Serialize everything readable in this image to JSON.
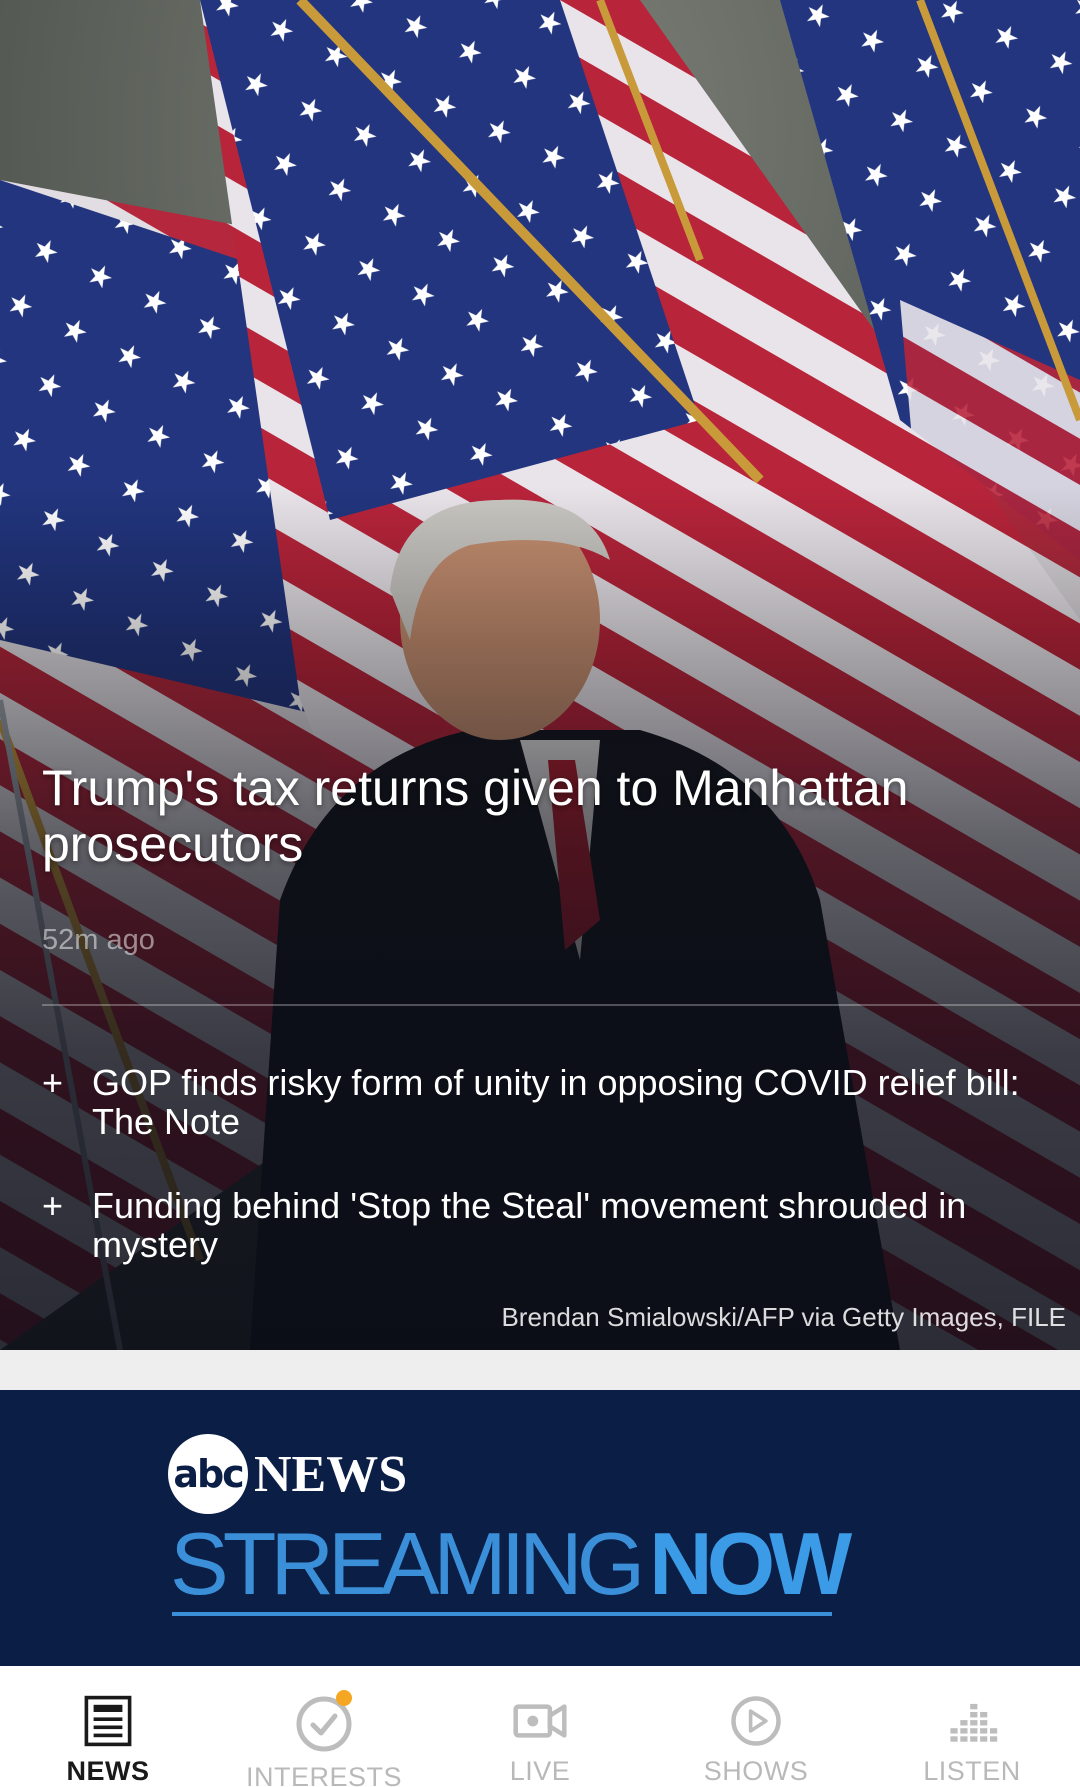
{
  "hero": {
    "title": "Trump's tax returns given to Manhattan prosecutors",
    "time_ago": "52m ago",
    "related": [
      {
        "icon": "plus-icon",
        "text": "GOP finds risky form of unity in opposing COVID relief bill: The Note"
      },
      {
        "icon": "plus-icon",
        "text": "Funding behind 'Stop the Steal' movement shrouded in mystery"
      }
    ],
    "photo_credit": "Brendan Smialowski/AFP via Getty Images, FILE"
  },
  "banner": {
    "logo_mark": "abc",
    "logo_word": "NEWS",
    "streaming_word": "STREAMING",
    "now_word": "NOW",
    "colors": {
      "background": "#0a1e46",
      "accent": "#3b8fd8"
    }
  },
  "bottom_nav": {
    "items": [
      {
        "label": "NEWS",
        "icon": "newspaper-icon",
        "active": true
      },
      {
        "label": "INTERESTS",
        "icon": "check-circle-icon",
        "active": false,
        "badge": true
      },
      {
        "label": "LIVE",
        "icon": "video-camera-icon",
        "active": false
      },
      {
        "label": "SHOWS",
        "icon": "play-circle-icon",
        "active": false
      },
      {
        "label": "LISTEN",
        "icon": "equalizer-icon",
        "active": false
      }
    ],
    "badge_color": "#f5a623"
  }
}
